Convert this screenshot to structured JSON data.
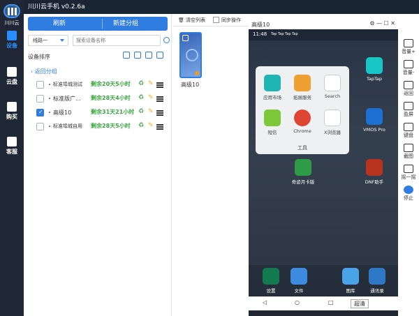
{
  "app": {
    "title": "川川云手机 v0.2.6a",
    "logo_text": "川川云"
  },
  "nav": [
    {
      "label": "设备",
      "active": true
    },
    {
      "label": "云盘"
    },
    {
      "label": "购买"
    },
    {
      "label": "客服"
    }
  ],
  "left": {
    "refresh": "刷新",
    "new_group": "新建分组",
    "line": "线路一",
    "search_placeholder": "搜索设备名称",
    "sort_label": "设备排序",
    "back": "返回分组",
    "rows": [
      {
        "name": "标准埠城测试",
        "remain": "剩余20天5小时",
        "checked": false
      },
      {
        "name": "标准版广...",
        "remain": "剩余28天4小时",
        "checked": false
      },
      {
        "name": "高级10",
        "remain": "剩余31天21小时",
        "checked": true
      },
      {
        "name": "标准埠城自用",
        "remain": "剩余28天5小时",
        "checked": false
      }
    ]
  },
  "toolbar": {
    "clear": "清空列表",
    "sync": "同步操作"
  },
  "thumb": {
    "label": "高级10"
  },
  "phone": {
    "title": "高级10",
    "time": "11:48",
    "status_tags": "Tap Tap Tap Tap",
    "folder_title": "工具",
    "folder_apps": [
      "应用市场",
      "拓展服务",
      "Search",
      "短信",
      "Chrome",
      "X浏览器"
    ],
    "home_apps": [
      "TapTap",
      "VMOS Pro",
      "奇迹月卡版",
      "DNF助手"
    ],
    "dock": [
      "设置",
      "文件",
      "图库",
      "通讯录"
    ],
    "nav_label": "超清"
  },
  "right": {
    "items": [
      "音量+",
      "音量-",
      "返回",
      "盈屏",
      "键盘",
      "截图",
      "摇一摇",
      "停止"
    ]
  },
  "colors": {
    "accent": "#2f7de1",
    "green": "#3aa640",
    "sidebar": "#1e2733"
  }
}
